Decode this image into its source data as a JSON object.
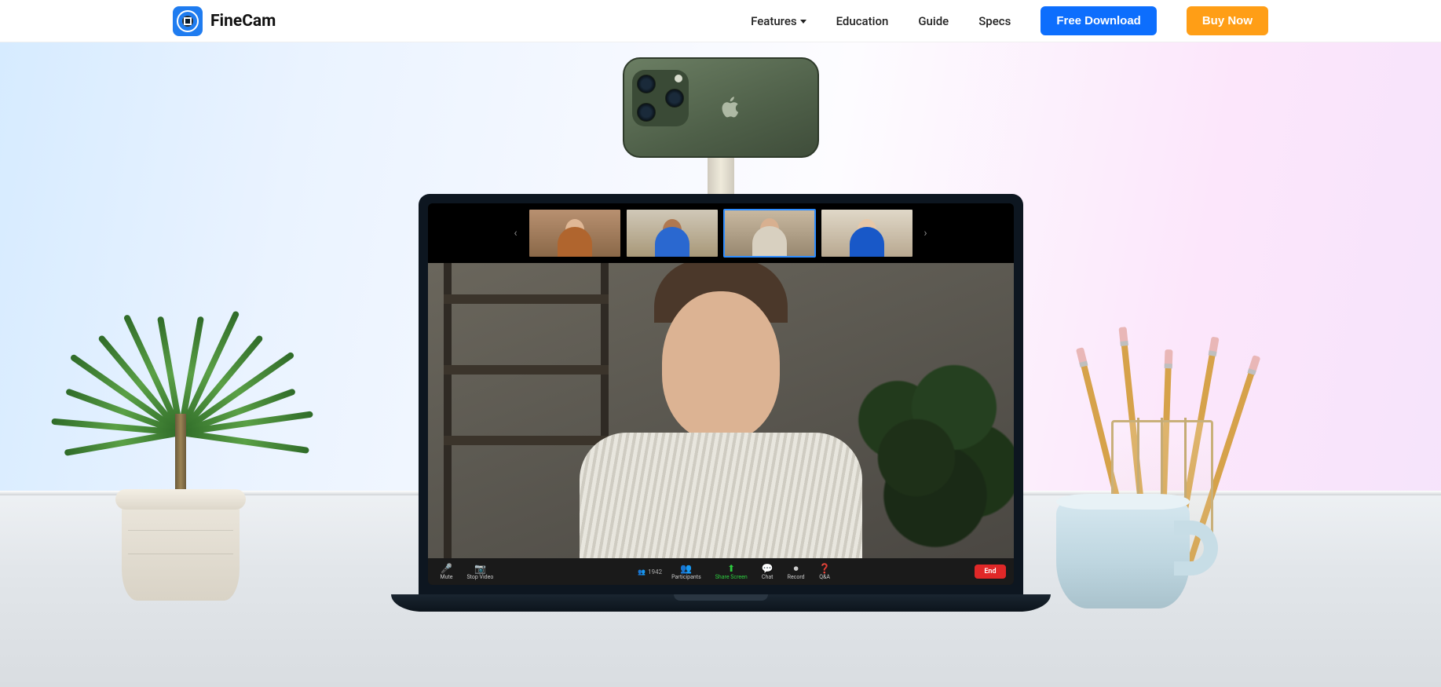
{
  "header": {
    "brand": "FineCam",
    "nav": {
      "features": "Features",
      "education": "Education",
      "guide": "Guide",
      "specs": "Specs"
    },
    "buttons": {
      "download": "Free Download",
      "buy": "Buy Now"
    }
  },
  "zoom": {
    "toolbar": {
      "mute": "Mute",
      "stop_video": "Stop Video",
      "participants": "Participants",
      "participants_count": "1942",
      "share_screen": "Share Screen",
      "chat": "Chat",
      "record": "Record",
      "qa": "Q&A",
      "end": "End"
    }
  }
}
